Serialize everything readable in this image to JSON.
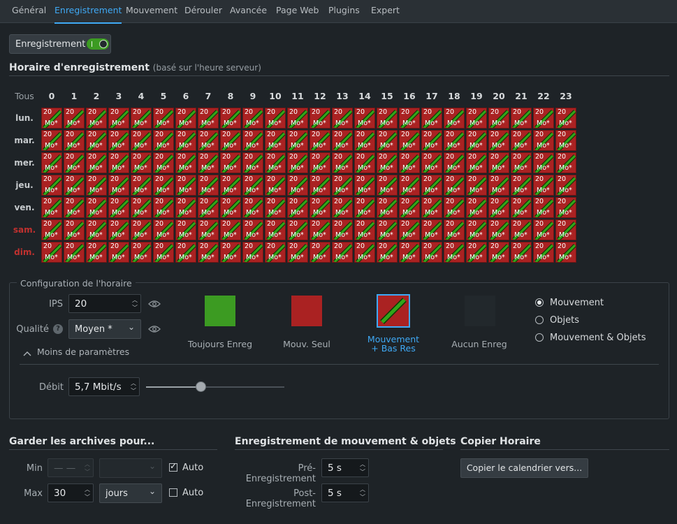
{
  "tabs": [
    {
      "label": "Général",
      "active": false
    },
    {
      "label": "Enregistrement",
      "active": true
    },
    {
      "label": "Mouvement",
      "active": false
    },
    {
      "label": "Dérouler",
      "active": false
    },
    {
      "label": "Avancée",
      "active": false
    },
    {
      "label": "Page Web",
      "active": false
    },
    {
      "label": "Plugins",
      "active": false
    },
    {
      "label": "Expert",
      "active": false
    }
  ],
  "recording_toggle": {
    "label": "Enregistrement",
    "on": true
  },
  "schedule": {
    "title": "Horaire d'enregistrement",
    "subtitle": "(basé sur l'heure serveur)",
    "all_label": "Tous",
    "hours": [
      "0",
      "1",
      "2",
      "3",
      "4",
      "5",
      "6",
      "7",
      "8",
      "9",
      "10",
      "11",
      "12",
      "13",
      "14",
      "15",
      "16",
      "17",
      "18",
      "19",
      "20",
      "21",
      "22",
      "23"
    ],
    "days": [
      {
        "label": "lun.",
        "weekend": false
      },
      {
        "label": "mar.",
        "weekend": false
      },
      {
        "label": "mer.",
        "weekend": false
      },
      {
        "label": "jeu.",
        "weekend": false
      },
      {
        "label": "ven.",
        "weekend": false
      },
      {
        "label": "sam.",
        "weekend": true
      },
      {
        "label": "dim.",
        "weekend": true
      }
    ],
    "cell_fps": "20",
    "cell_quality": "Mo*",
    "cell_color": "#aa2222",
    "stripe_color": "#33a61a"
  },
  "config": {
    "title": "Configuration de l'horaire",
    "fps_label": "IPS",
    "fps_value": "20",
    "quality_label": "Qualité",
    "quality_value": "Moyen *",
    "less_params": "Moins de paramètres",
    "bitrate_label": "Débit",
    "bitrate_value": "5,7 Mbit/s",
    "bitrate_level": 0.4,
    "modes": [
      {
        "label": "Toujours Enreg",
        "color": "#3c9b22",
        "selected": false
      },
      {
        "label": "Mouv. Seul",
        "color": "#aa2222",
        "selected": false
      },
      {
        "label": "Mouvement\n+ Bas Res",
        "color": "#aa2222",
        "selected": true
      },
      {
        "label": "Aucun Enreg",
        "color": "#22282c",
        "selected": false
      }
    ],
    "triggers": [
      {
        "label": "Mouvement",
        "checked": true
      },
      {
        "label": "Objets",
        "checked": false
      },
      {
        "label": "Mouvement & Objets",
        "checked": false
      }
    ]
  },
  "archive": {
    "title": "Garder les archives pour...",
    "min_label": "Min",
    "min_value": "— —",
    "min_unit": "",
    "min_auto_label": "Auto",
    "min_auto": true,
    "max_label": "Max",
    "max_value": "30",
    "max_unit": "jours",
    "max_auto_label": "Auto",
    "max_auto": false
  },
  "motion_recording": {
    "title": "Enregistrement de mouvement & objets",
    "pre_label": "Pré-Enregistrement",
    "pre_value": "5 s",
    "post_label": "Post-Enregistrement",
    "post_value": "5 s"
  },
  "copy_schedule": {
    "title": "Copier Horaire",
    "button_label": "Copier le calendrier vers..."
  }
}
